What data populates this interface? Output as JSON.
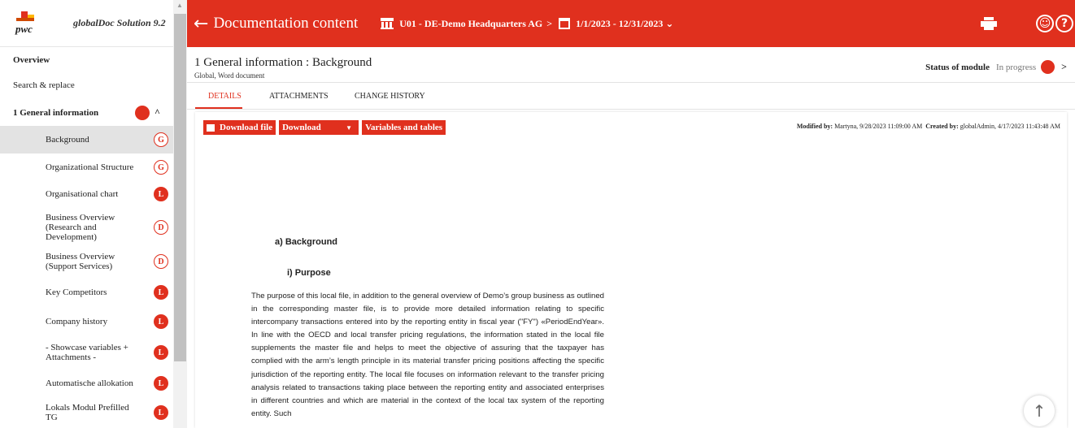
{
  "app": {
    "logo_text": "pwc",
    "name": "globalDoc Solution 9.2"
  },
  "sidebar": {
    "overview": "Overview",
    "search_replace": "Search & replace",
    "section": "1 General information",
    "items": [
      {
        "label": "Background",
        "badge": "G"
      },
      {
        "label": "Organizational Structure",
        "badge": "G"
      },
      {
        "label": "Organisational chart",
        "badge": "L"
      },
      {
        "label": "Business Overview (Research and Development)",
        "badge": "D"
      },
      {
        "label": "Business Overview (Support Services)",
        "badge": "D"
      },
      {
        "label": "Key Competitors",
        "badge": "L"
      },
      {
        "label": "Company history",
        "badge": "L"
      },
      {
        "label": "- Showcase variables + Attachments -",
        "badge": "L"
      },
      {
        "label": "Automatische allokation",
        "badge": "L"
      },
      {
        "label": "Lokals Modul Prefilled TG",
        "badge": "L"
      }
    ]
  },
  "header": {
    "title": "Documentation content",
    "entity": "U01 - DE-Demo Headquarters AG",
    "period": "1/1/2023 - 12/31/2023",
    "print_icon": "printer-icon",
    "user_icon": "user-icon",
    "help_icon": "help-icon"
  },
  "module": {
    "title": "1 General information : Background",
    "subtitle": "Global, Word document",
    "status_label": "Status of module",
    "status_value": "In progress"
  },
  "tabs": [
    "DETAILS",
    "ATTACHMENTS",
    "CHANGE HISTORY"
  ],
  "toolbar": {
    "download_file": "Download file",
    "download_select": "Download",
    "variables": "Variables and tables"
  },
  "meta": {
    "modified_label": "Modified by:",
    "modified_value": "Martyna, 9/28/2023 11:09:00 AM",
    "created_label": "Created by:",
    "created_value": "globalAdmin, 4/17/2023 11:43:48 AM"
  },
  "document": {
    "heading": "a)  Background",
    "subheading": "i)  Purpose",
    "paragraph": "The purpose of this local file, in addition to the general overview of Demo’s group business as outlined in the corresponding master file, is to provide more detailed information relating to specific intercompany transactions entered into by the reporting entity in fiscal year (\"FY\") «PeriodEndYear». In line with the OECD and local transfer pricing regulations, the information stated in the local file supplements the master file and helps to meet the objective of assuring that the taxpayer has complied with the arm’s length principle in its material transfer pricing positions affecting the specific jurisdiction of the reporting entity. The local file focuses on information relevant to the transfer pricing analysis related to transactions taking place between the reporting entity and associated enterprises in different countries and which are material in the context of the local tax system of the reporting entity. Such"
  },
  "colors": {
    "accent": "#e0301e",
    "selected_bg": "#e3e3e3"
  }
}
